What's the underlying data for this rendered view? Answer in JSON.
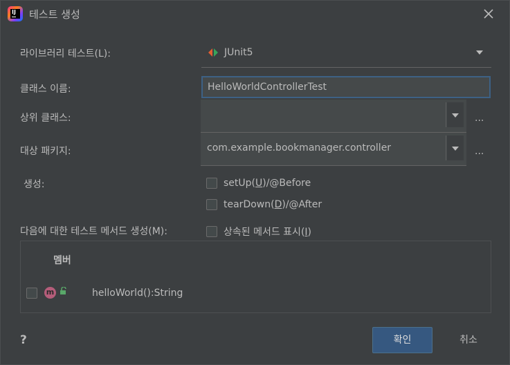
{
  "window": {
    "title": "테스트 생성",
    "app_icon": "intellij-icon",
    "close_icon": "close-icon"
  },
  "library": {
    "label": "라이브러리 테스트(L):",
    "value": "JUnit5",
    "icon": "junit-icon"
  },
  "class_name": {
    "label": "클래스 이름:",
    "value": "HelloWorldControllerTest"
  },
  "superclass": {
    "label": "상위 클래스:",
    "value": "",
    "browse": "..."
  },
  "package": {
    "label": "대상 패키지:",
    "value": "com.example.bookmanager.controller",
    "browse": "..."
  },
  "generate": {
    "label": "생성:",
    "setup": {
      "pre": "setUp(",
      "mnemonic": "U",
      "post": ")/@Before",
      "checked": false
    },
    "teardown": {
      "pre": "tearDown(",
      "mnemonic": "D",
      "post": ")/@After",
      "checked": false
    }
  },
  "methods": {
    "label": "다음에 대한 테스트 메서드 생성(M):",
    "inherited": {
      "pre": "상속된 메서드 표시(",
      "mnemonic": "I",
      "post": ")",
      "checked": false
    }
  },
  "members": {
    "header": "멤버",
    "rows": [
      {
        "icon": "method-icon",
        "icon_letter": "m",
        "text": "helloWorld():String",
        "checked": false
      }
    ]
  },
  "footer": {
    "help": "?",
    "ok": "확인",
    "cancel": "취소"
  },
  "colors": {
    "accent_button": "#365880",
    "focus_border": "#3d6185",
    "background": "#3c3f41"
  }
}
